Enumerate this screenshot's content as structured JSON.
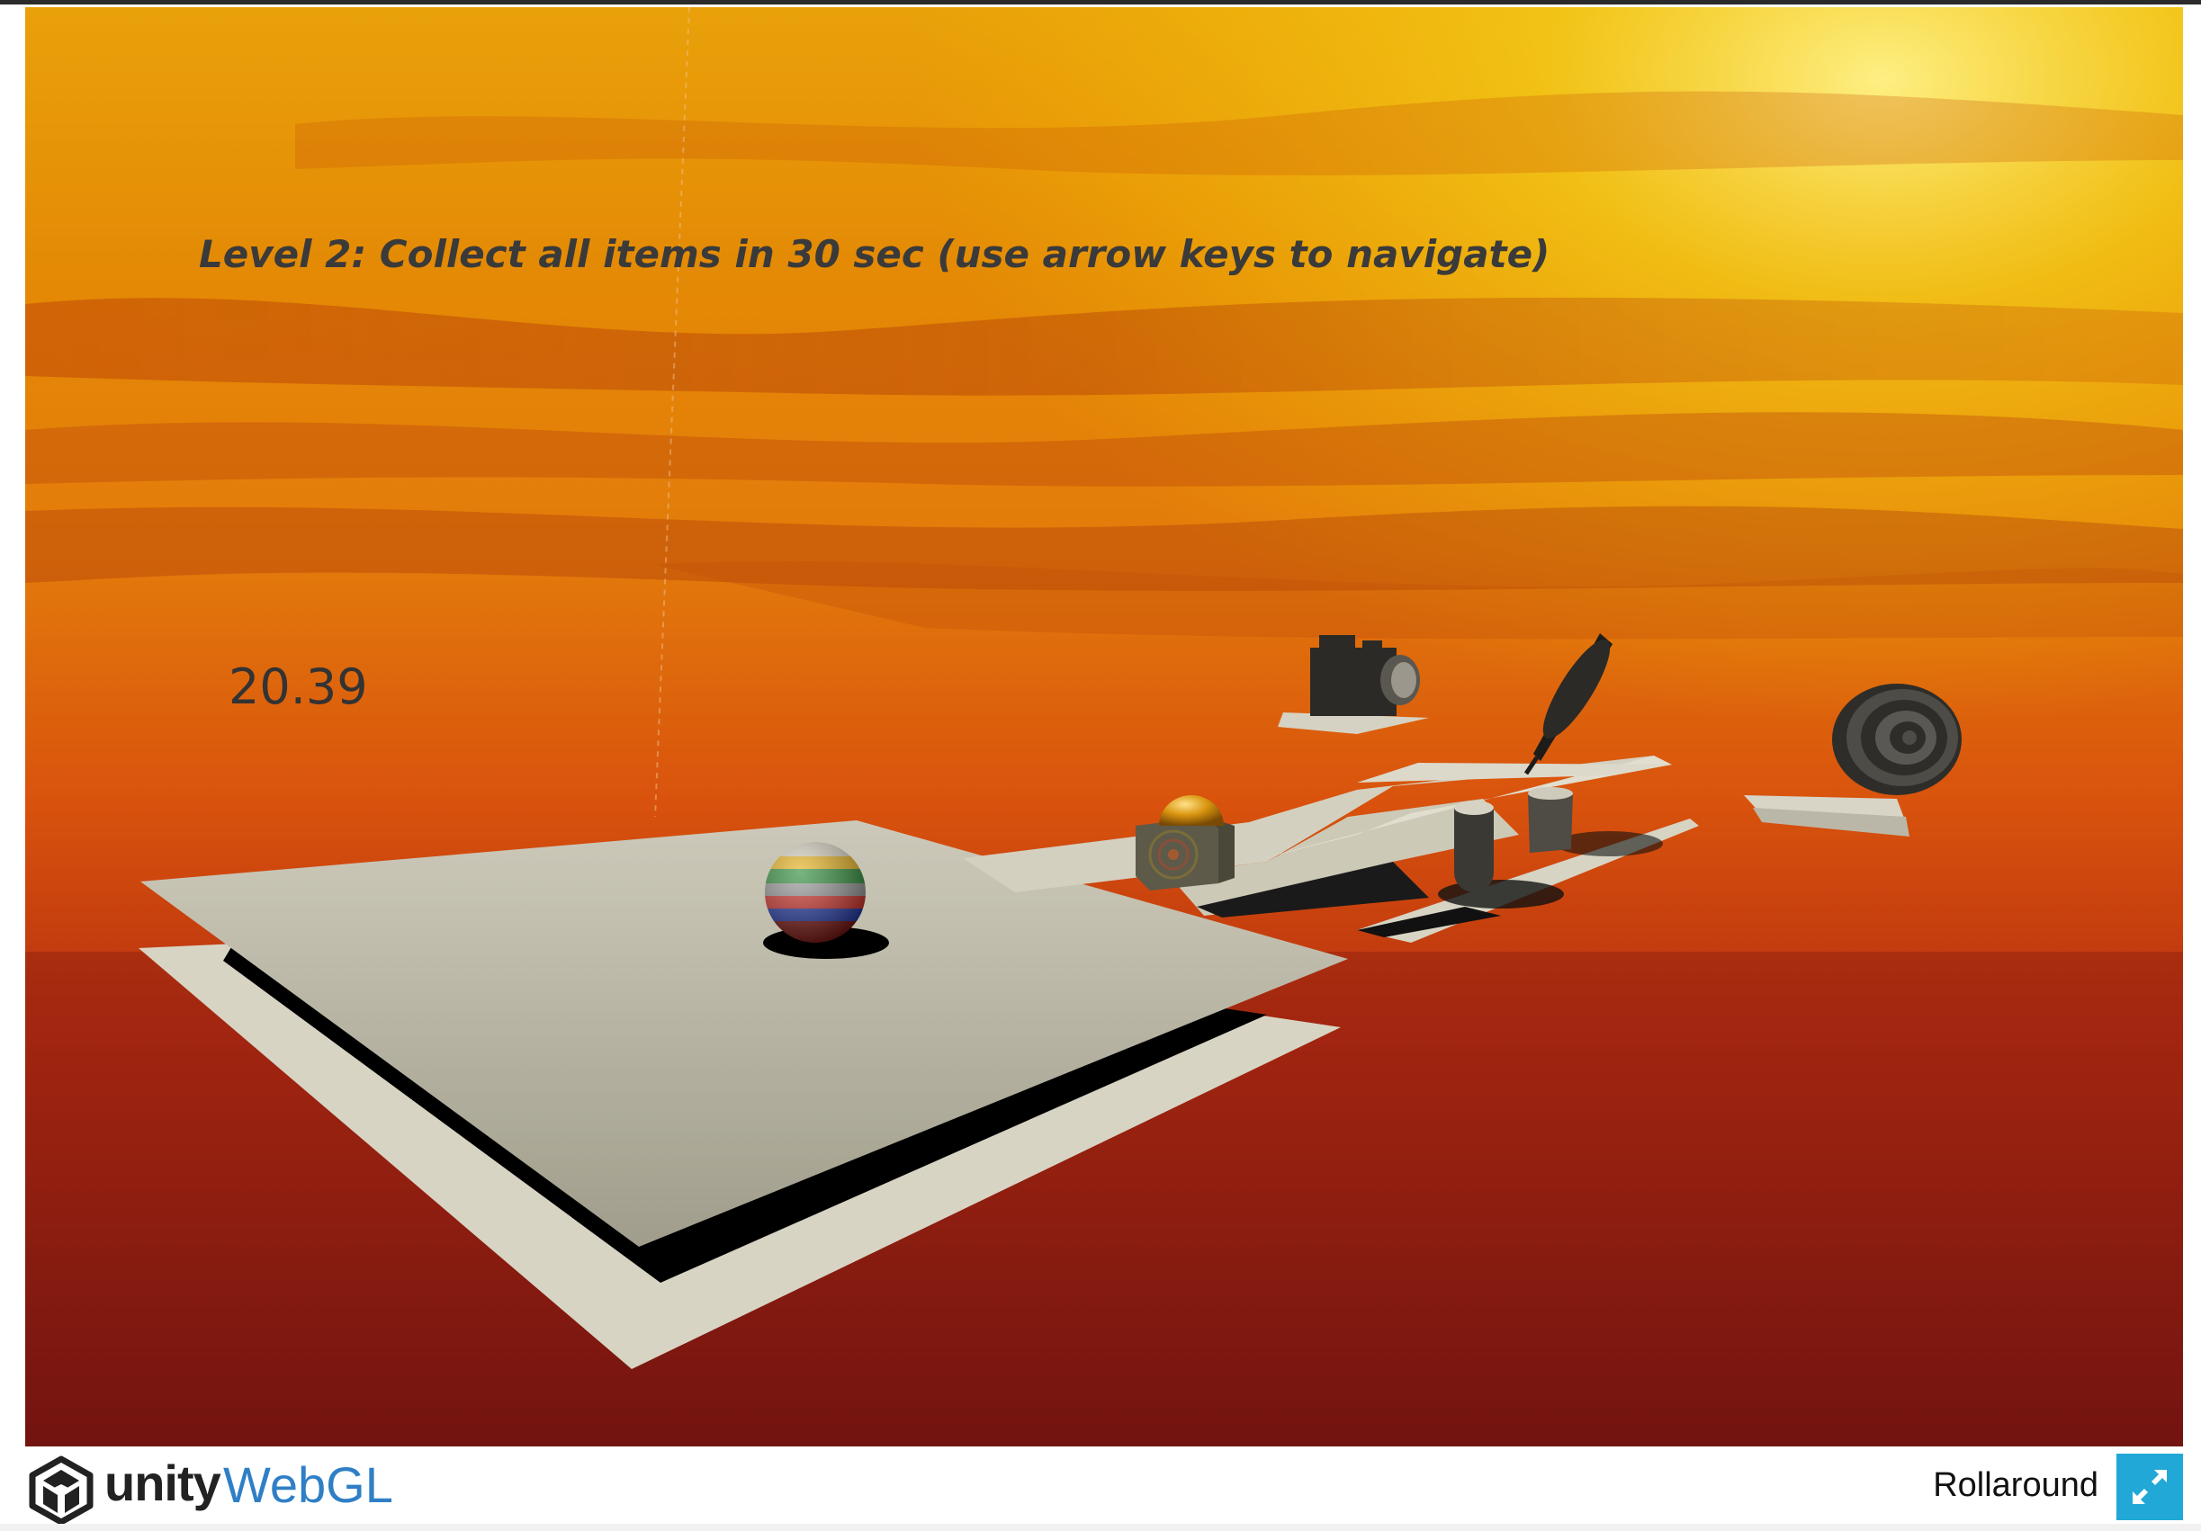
{
  "game": {
    "instructions": "Level 2: Collect all items in 30 sec (use arrow keys to navigate)",
    "timer": "20.39",
    "sky_colors": [
      "#f5c400",
      "#e98a00",
      "#c8400a",
      "#8a0f0a"
    ],
    "collectibles": [
      "camera-icon",
      "pen-icon",
      "speaker-icon",
      "cup-icon",
      "gold-dome-box-icon"
    ],
    "player": "striped-ball"
  },
  "footer": {
    "brand": "unity",
    "product": "WebGL",
    "app_title": "Rollaround",
    "accent_color": "#22a8d6",
    "fullscreen_icon": "fullscreen-icon"
  }
}
